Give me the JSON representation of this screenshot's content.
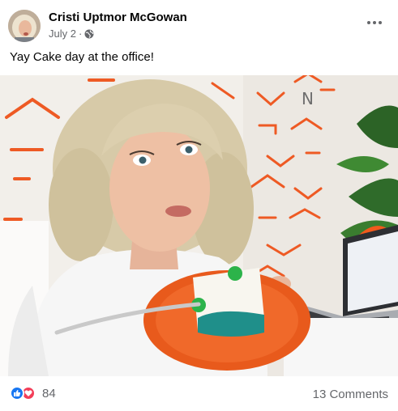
{
  "post": {
    "author": "Cristi Uptmor McGowan",
    "date": "July 2",
    "separator": "·",
    "privacy_icon": "globe-icon",
    "more_icon": "more-options-icon",
    "caption": "Yay Cake day at the office!"
  },
  "photo": {
    "wall_letter": "N"
  },
  "footer": {
    "reaction_icons": [
      "like-icon",
      "love-icon"
    ],
    "reaction_count": "84",
    "comments_label": "13 Comments"
  },
  "colors": {
    "brand_blue": "#1877f2",
    "love_red": "#f33e58",
    "accent_orange": "#ee5a24",
    "muted_text": "#65676b"
  }
}
